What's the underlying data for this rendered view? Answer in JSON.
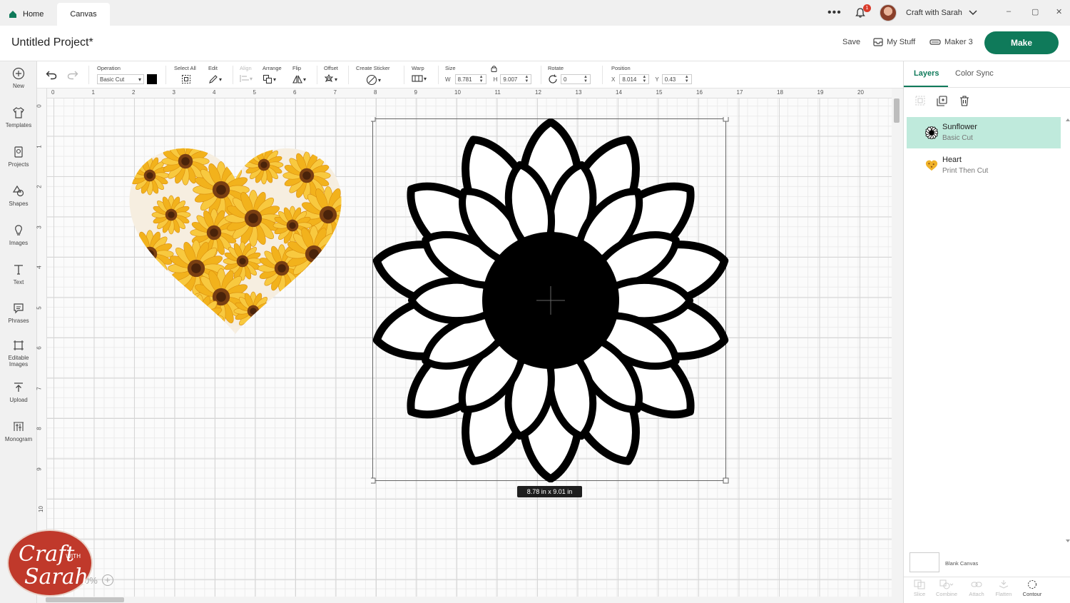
{
  "tabs": {
    "home": "Home",
    "canvas": "Canvas"
  },
  "topbar": {
    "notification_count": "1",
    "account_name": "Craft with Sarah"
  },
  "header": {
    "project_title": "Untitled Project*",
    "save": "Save",
    "my_stuff": "My Stuff",
    "machine": "Maker 3",
    "make": "Make"
  },
  "sidebar": {
    "items": [
      {
        "label": "New",
        "icon": "plus-circle-icon"
      },
      {
        "label": "Templates",
        "icon": "shirt-icon"
      },
      {
        "label": "Projects",
        "icon": "projects-icon"
      },
      {
        "label": "Shapes",
        "icon": "shapes-icon"
      },
      {
        "label": "Images",
        "icon": "lightbulb-icon"
      },
      {
        "label": "Text",
        "icon": "text-icon"
      },
      {
        "label": "Phrases",
        "icon": "speech-bubble-icon"
      },
      {
        "label": "Editable",
        "label2": "Images",
        "icon": "editable-images-icon"
      },
      {
        "label": "Upload",
        "icon": "upload-icon"
      },
      {
        "label": "Monogram",
        "icon": "monogram-icon"
      }
    ]
  },
  "toolbar": {
    "operation_label": "Operation",
    "operation_value": "Basic Cut",
    "operation_color": "#000000",
    "select_all": "Select All",
    "edit": "Edit",
    "align": "Align",
    "arrange": "Arrange",
    "flip": "Flip",
    "offset": "Offset",
    "create_sticker": "Create Sticker",
    "warp": "Warp",
    "size": "Size",
    "w_label": "W",
    "w_value": "8.781",
    "h_label": "H",
    "h_value": "9.007",
    "rotate": "Rotate",
    "rotate_value": "0",
    "position": "Position",
    "x_label": "X",
    "x_value": "8.014",
    "y_label": "Y",
    "y_value": "0.43"
  },
  "rulers": {
    "top": [
      "0",
      "1",
      "2",
      "3",
      "4",
      "5",
      "6",
      "7",
      "8",
      "9",
      "10",
      "11",
      "12",
      "13",
      "14",
      "15",
      "16",
      "17",
      "18",
      "19",
      "20"
    ],
    "left": [
      "0",
      "1",
      "2",
      "3",
      "4",
      "5",
      "6",
      "7",
      "8",
      "9",
      "10"
    ]
  },
  "canvas": {
    "size_tooltip": "8.78  in x 9.01  in",
    "zoom_text": "0%"
  },
  "panel": {
    "tab_layers": "Layers",
    "tab_color_sync": "Color Sync",
    "layers": [
      {
        "name": "Sunflower",
        "operation": "Basic Cut",
        "icon": "sunflower-thumb-icon"
      },
      {
        "name": "Heart",
        "operation": "Print Then Cut",
        "icon": "heart-thumb-icon"
      }
    ],
    "blank_canvas": "Blank Canvas",
    "bottom_actions": [
      "Slice",
      "Combine",
      "Attach",
      "Flatten",
      "Contour"
    ]
  },
  "colors": {
    "accent": "#0f7a5a",
    "selected_layer": "#bfeadc",
    "badge": "#d93b2b"
  }
}
